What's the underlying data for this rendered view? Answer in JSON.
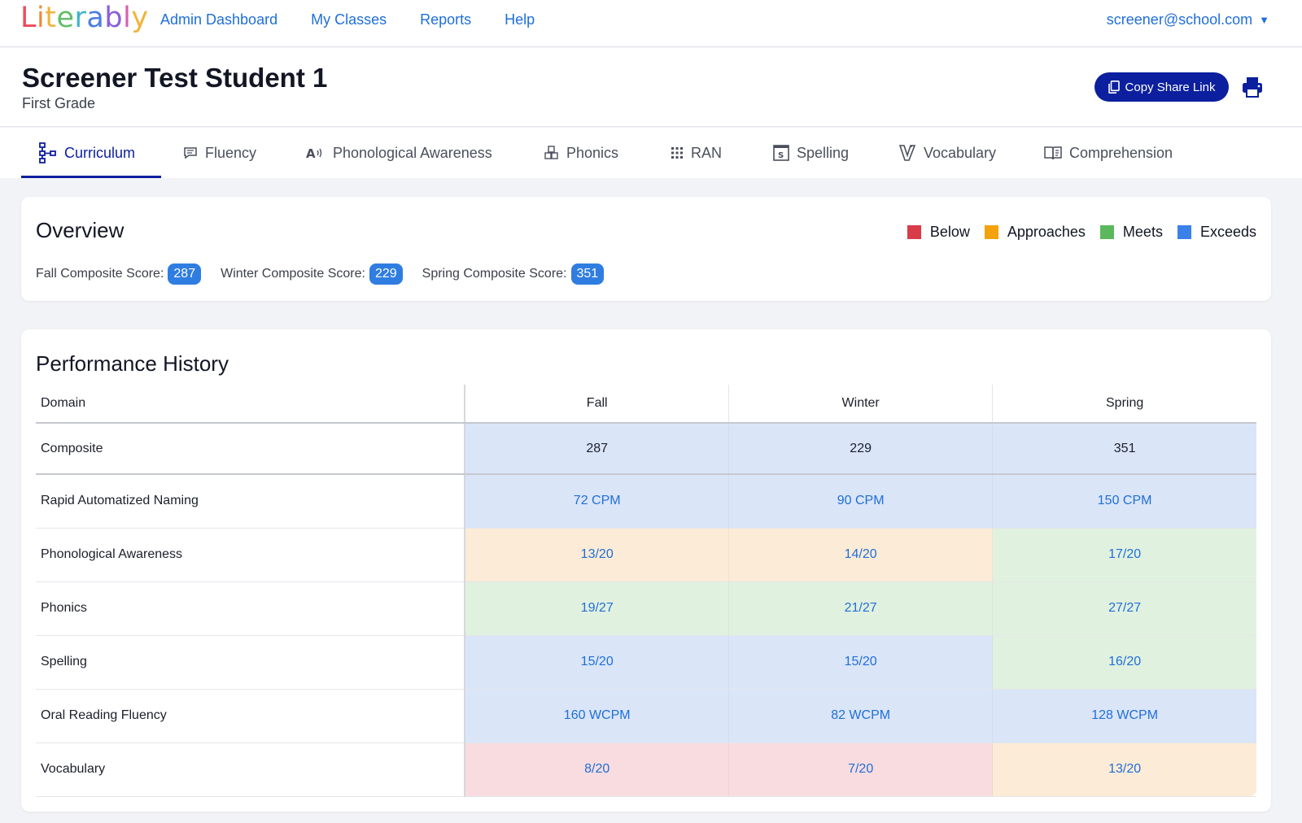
{
  "brand": {
    "letters": [
      {
        "ch": "L",
        "color": "#ef4b5c"
      },
      {
        "ch": "i",
        "color": "#f08a3c"
      },
      {
        "ch": "t",
        "color": "#f0b43c"
      },
      {
        "ch": "e",
        "color": "#5fbf6a"
      },
      {
        "ch": "r",
        "color": "#3fb4c8"
      },
      {
        "ch": "a",
        "color": "#4a7fe0"
      },
      {
        "ch": "b",
        "color": "#8a5fd8"
      },
      {
        "ch": "l",
        "color": "#d85fb0"
      },
      {
        "ch": "y",
        "color": "#f0b43c"
      }
    ],
    "word": "Literably"
  },
  "nav": {
    "links": [
      "Admin Dashboard",
      "My Classes",
      "Reports",
      "Help"
    ],
    "user": "screener@school.com"
  },
  "student": {
    "name": "Screener Test Student 1",
    "grade": "First Grade",
    "share_label": "Copy Share Link"
  },
  "tabs": [
    {
      "label": "Curriculum",
      "icon": "hierarchy-icon",
      "active": true
    },
    {
      "label": "Fluency",
      "icon": "speech-bubble-icon",
      "active": false
    },
    {
      "label": "Phonological Awareness",
      "icon": "sound-letter-icon",
      "active": false
    },
    {
      "label": "Phonics",
      "icon": "blocks-icon",
      "active": false
    },
    {
      "label": "RAN",
      "icon": "grid-dots-icon",
      "active": false
    },
    {
      "label": "Spelling",
      "icon": "spelling-tile-icon",
      "active": false
    },
    {
      "label": "Vocabulary",
      "icon": "book-v-icon",
      "active": false
    },
    {
      "label": "Comprehension",
      "icon": "open-book-icon",
      "active": false
    }
  ],
  "overview": {
    "title": "Overview",
    "legend": [
      {
        "label": "Below",
        "color": "#d93b48"
      },
      {
        "label": "Approaches",
        "color": "#f5a20c"
      },
      {
        "label": "Meets",
        "color": "#5cb85c"
      },
      {
        "label": "Exceeds",
        "color": "#3a82ea"
      }
    ],
    "scores": [
      {
        "label": "Fall Composite Score:",
        "value": "287"
      },
      {
        "label": "Winter Composite Score:",
        "value": "229"
      },
      {
        "label": "Spring Composite Score:",
        "value": "351"
      }
    ]
  },
  "performance": {
    "title": "Performance History",
    "columns": [
      "Domain",
      "Fall",
      "Winter",
      "Spring"
    ],
    "rows": [
      {
        "domain": "Composite",
        "cells": [
          {
            "v": "287",
            "level": "exceeds"
          },
          {
            "v": "229",
            "level": "exceeds"
          },
          {
            "v": "351",
            "level": "exceeds"
          }
        ]
      },
      {
        "domain": "Rapid Automatized Naming",
        "cells": [
          {
            "v": "72 CPM",
            "level": "exceeds"
          },
          {
            "v": "90 CPM",
            "level": "exceeds"
          },
          {
            "v": "150 CPM",
            "level": "exceeds"
          }
        ]
      },
      {
        "domain": "Phonological Awareness",
        "cells": [
          {
            "v": "13/20",
            "level": "approaches"
          },
          {
            "v": "14/20",
            "level": "approaches"
          },
          {
            "v": "17/20",
            "level": "meets"
          }
        ]
      },
      {
        "domain": "Phonics",
        "cells": [
          {
            "v": "19/27",
            "level": "meets"
          },
          {
            "v": "21/27",
            "level": "meets"
          },
          {
            "v": "27/27",
            "level": "meets"
          }
        ]
      },
      {
        "domain": "Spelling",
        "cells": [
          {
            "v": "15/20",
            "level": "exceeds"
          },
          {
            "v": "15/20",
            "level": "exceeds"
          },
          {
            "v": "16/20",
            "level": "meets"
          }
        ]
      },
      {
        "domain": "Oral Reading Fluency",
        "cells": [
          {
            "v": "160 WCPM",
            "level": "exceeds"
          },
          {
            "v": "82 WCPM",
            "level": "exceeds"
          },
          {
            "v": "128 WCPM",
            "level": "exceeds"
          }
        ]
      },
      {
        "domain": "Vocabulary",
        "cells": [
          {
            "v": "8/20",
            "level": "below"
          },
          {
            "v": "7/20",
            "level": "below"
          },
          {
            "v": "13/20",
            "level": "approaches"
          }
        ]
      }
    ]
  }
}
